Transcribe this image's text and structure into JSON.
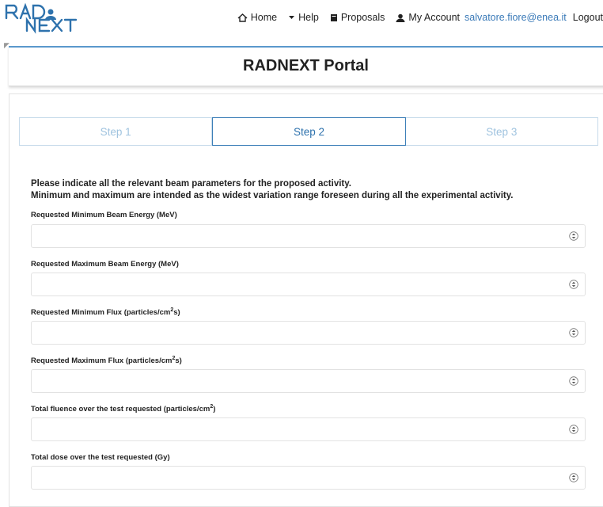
{
  "brand": {
    "logo_line1": "RAD",
    "logo_line2": "NEXT"
  },
  "nav": {
    "home": "Home",
    "help": "Help",
    "proposals": "Proposals",
    "account": "My Account",
    "email": "salvatore.fiore@enea.it",
    "logout": "Logout"
  },
  "page_title": "RADNEXT Portal",
  "steps": [
    {
      "label": "Step 1",
      "active": false
    },
    {
      "label": "Step 2",
      "active": true
    },
    {
      "label": "Step 3",
      "active": false
    }
  ],
  "intro": {
    "line1": "Please indicate all the relevant beam parameters for the proposed activity.",
    "line2": "Minimum and maximum are intended as the widest variation range foreseen during all the experimental activity."
  },
  "fields": {
    "min_energy": {
      "label": "Requested Minimum Beam Energy (MeV)",
      "value": ""
    },
    "max_energy": {
      "label": "Requested Maximum Beam Energy (MeV)",
      "value": ""
    },
    "min_flux": {
      "label_pre": "Requested Minimum Flux (particles/cm",
      "sup": "2",
      "label_post": "s)",
      "value": ""
    },
    "max_flux": {
      "label_pre": "Requested Maximum Flux (particles/cm",
      "sup": "2",
      "label_post": "s)",
      "value": ""
    },
    "fluence": {
      "label_pre": "Total fluence over the test requested (particles/cm",
      "sup": "2",
      "label_post": ")",
      "value": ""
    },
    "dose": {
      "label": "Total dose over the test requested (Gy)",
      "value": ""
    }
  },
  "colors": {
    "accent": "#2e72ad",
    "step_inactive": "#9fc3df",
    "link": "#3a7ab8"
  }
}
